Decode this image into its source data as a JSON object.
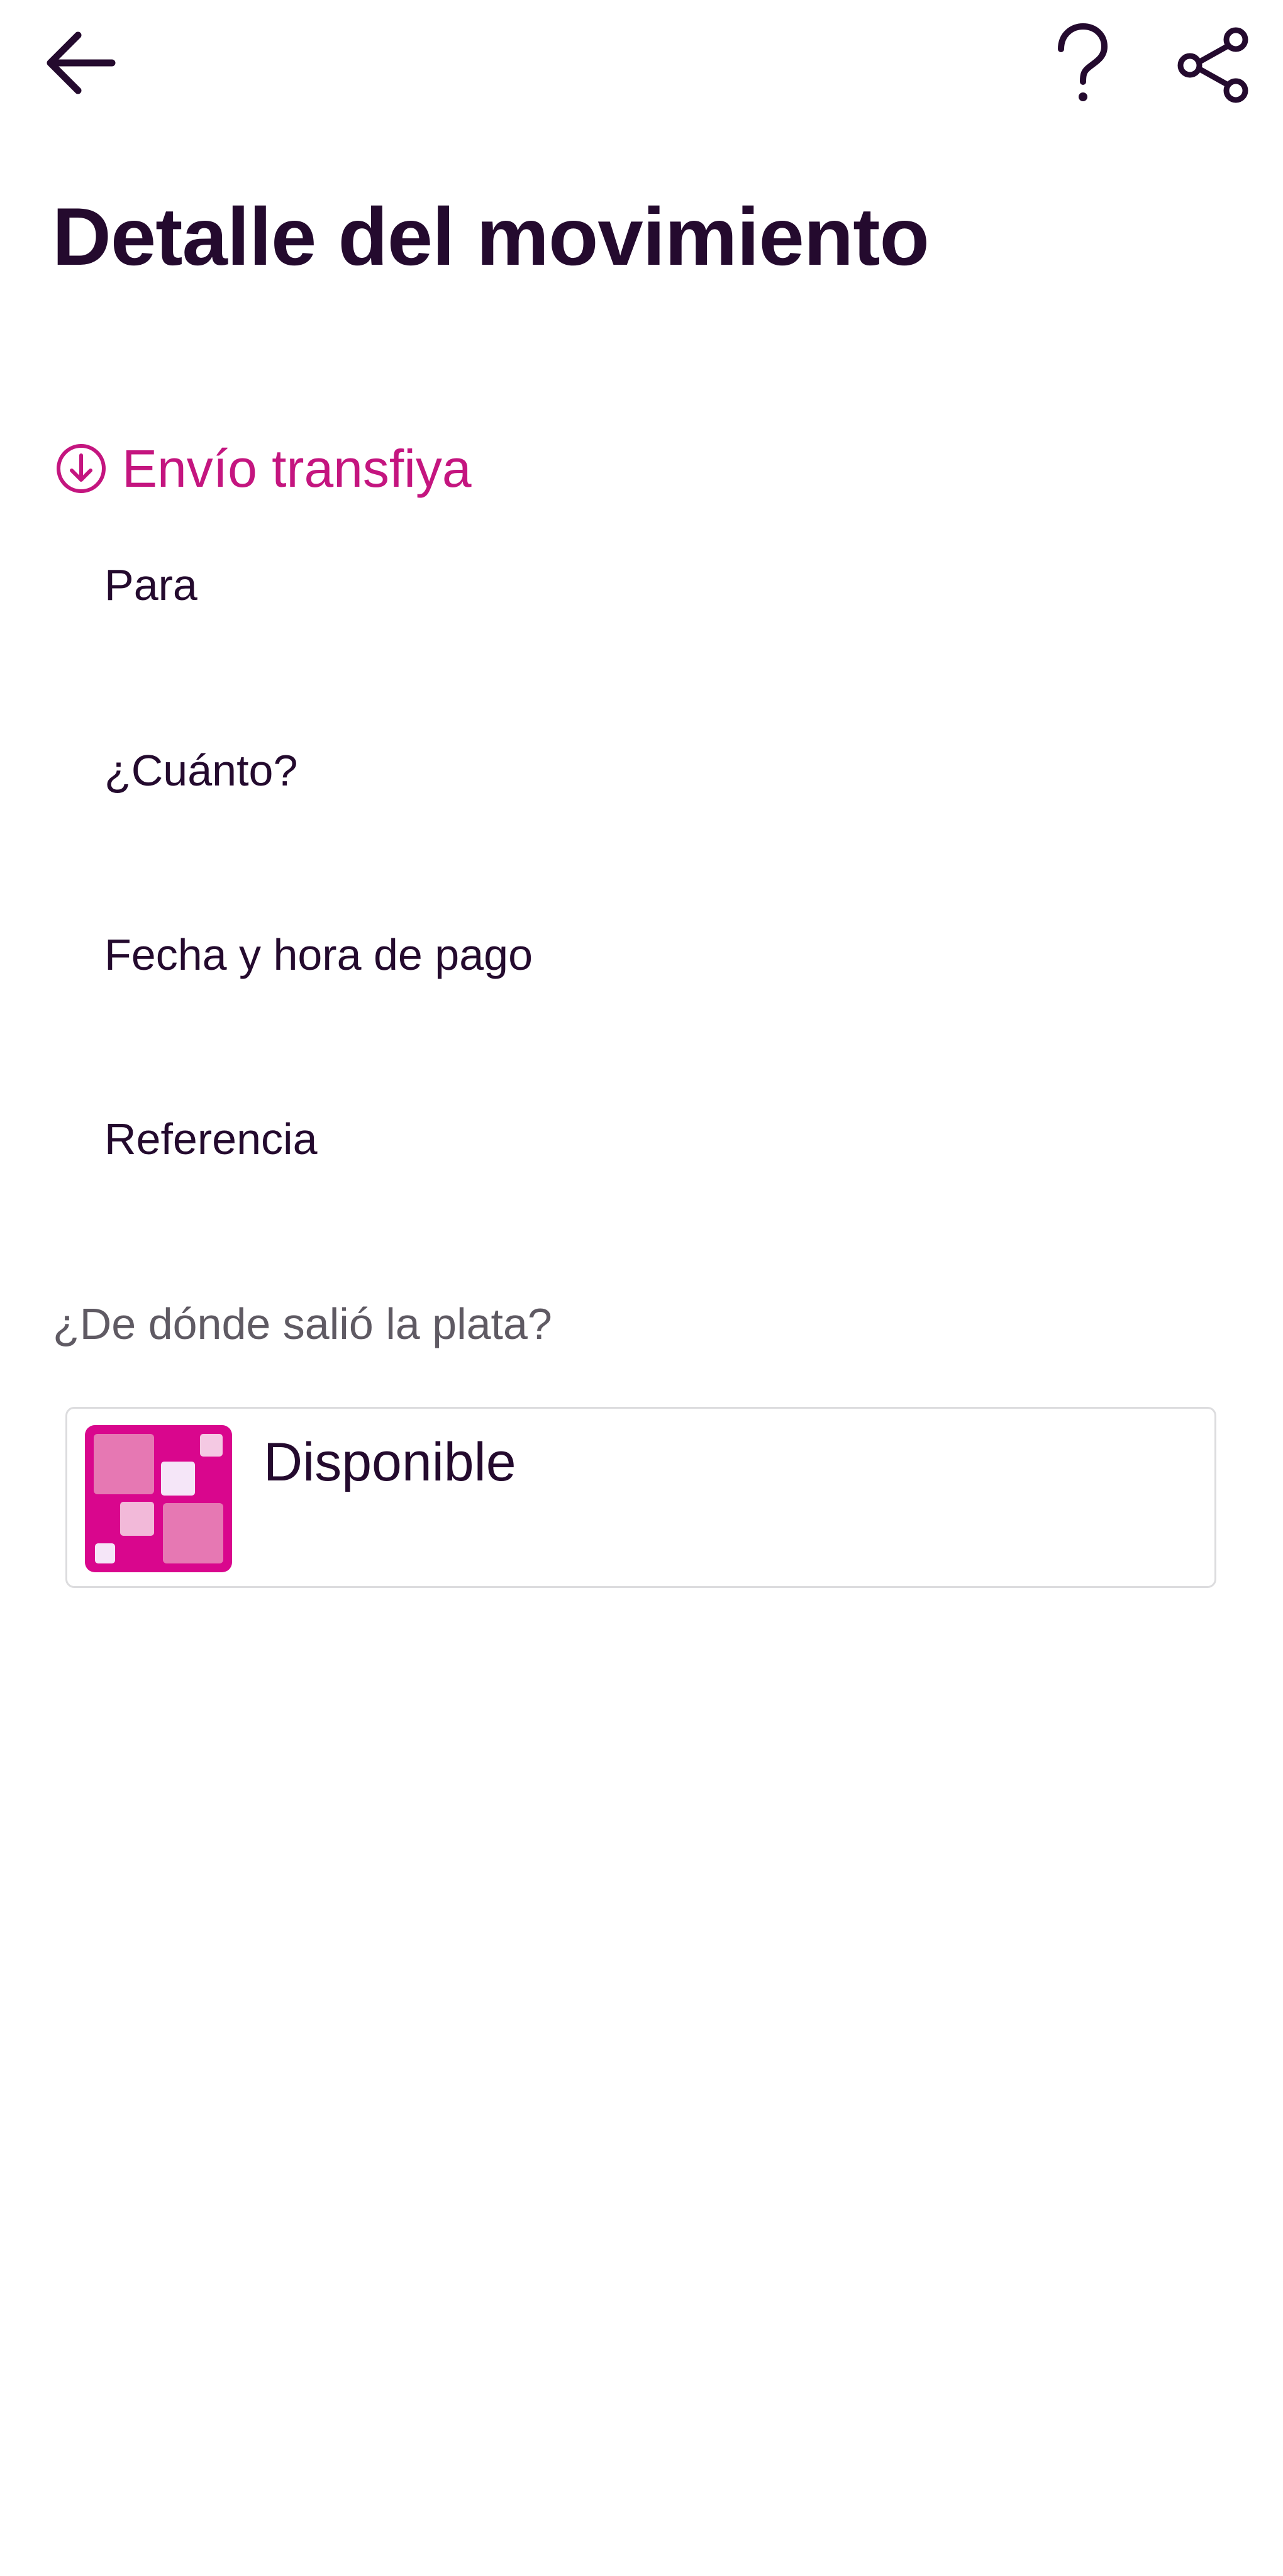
{
  "header": {
    "back_icon": "arrow-left-icon",
    "help_icon": "question-mark-icon",
    "share_icon": "share-icon"
  },
  "page": {
    "title": "Detalle del movimiento"
  },
  "transaction": {
    "type_label": "Envío transfiya",
    "type_icon": "arrow-down-circle-icon",
    "accent_color": "#c4157f"
  },
  "details": {
    "para_label": "Para",
    "amount_label": "¿Cuánto?",
    "datetime_label": "Fecha y hora de pago",
    "reference_label": "Referencia"
  },
  "source": {
    "question": "¿De dónde salió la plata?",
    "account_label": "Disponible",
    "account_icon": "pink-squares-pocket-icon"
  },
  "colors": {
    "text_primary": "#240a2e",
    "text_secondary": "#5f5a63",
    "brand_magenta": "#d9068d",
    "card_border": "#dcdcde"
  }
}
